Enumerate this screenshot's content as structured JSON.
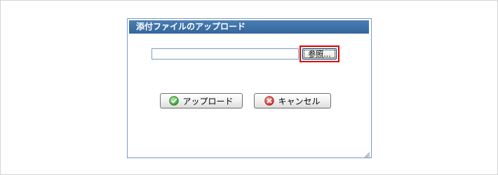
{
  "dialog": {
    "title": "添付ファイルのアップロード"
  },
  "file_input": {
    "value": ""
  },
  "browse_button": {
    "label": "参照..."
  },
  "upload_button": {
    "label": "アップロード",
    "icon": "check-circle-icon"
  },
  "cancel_button": {
    "label": "キャンセル",
    "icon": "close-circle-icon"
  },
  "colors": {
    "titlebar": "#336699",
    "highlight": "#e00000",
    "upload_icon": "#3aa53a",
    "cancel_icon": "#d63a3a"
  }
}
